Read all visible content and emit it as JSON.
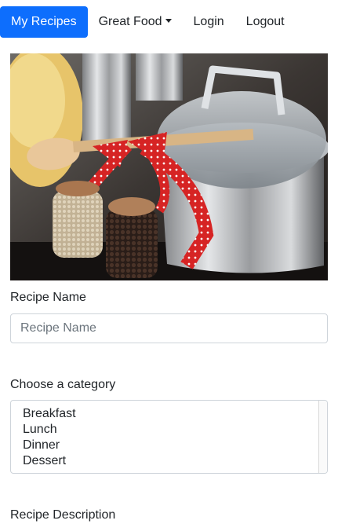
{
  "nav": {
    "brand": "My Recipes",
    "items": [
      {
        "label": "Great Food",
        "has_dropdown": true
      },
      {
        "label": "Login"
      },
      {
        "label": "Logout"
      }
    ],
    "accent_color": "#0d6efd"
  },
  "hero": {
    "alt": "Kitchen photo with a steel pot, wooden spoon with red polka-dot ribbon and jars of spices"
  },
  "form": {
    "recipe_name_label": "Recipe Name",
    "recipe_name_placeholder": "Recipe Name",
    "recipe_name_value": "",
    "category_label": "Choose a category",
    "categories": [
      "Breakfast",
      "Lunch",
      "Dinner",
      "Dessert"
    ],
    "description_label": "Recipe Description"
  }
}
